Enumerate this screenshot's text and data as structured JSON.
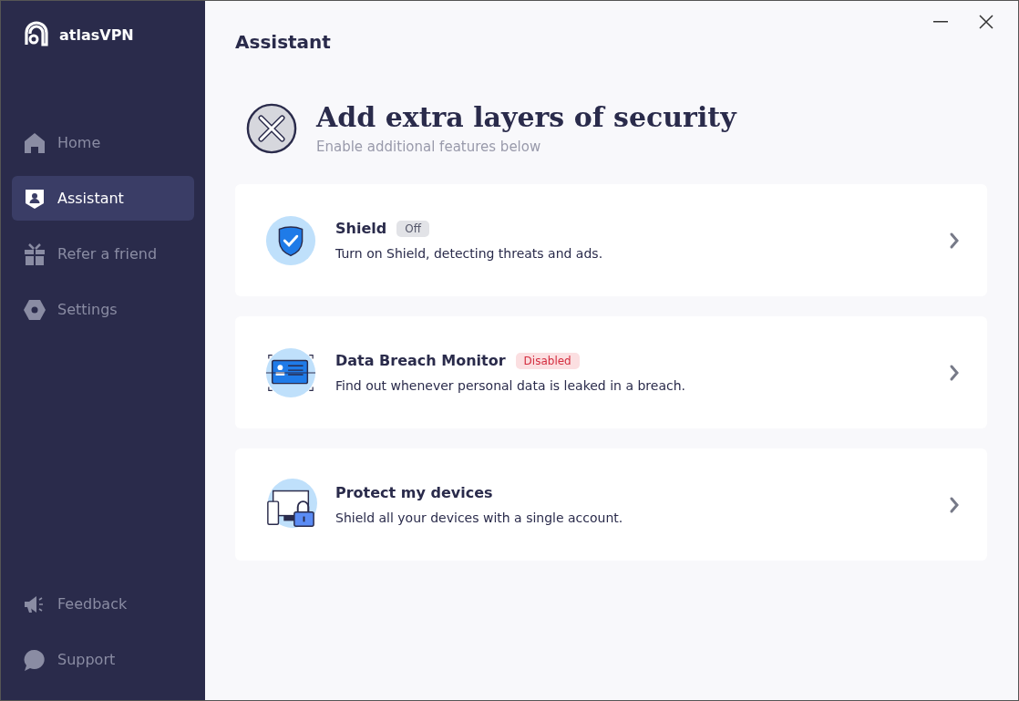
{
  "brand": {
    "name": "atlasVPN"
  },
  "sidebar": {
    "items": [
      {
        "label": "Home",
        "kind": "home",
        "selected": false
      },
      {
        "label": "Assistant",
        "kind": "assistant",
        "selected": true
      },
      {
        "label": "Refer a friend",
        "kind": "gift",
        "selected": false
      },
      {
        "label": "Settings",
        "kind": "settings",
        "selected": false
      }
    ],
    "footer_items": [
      {
        "label": "Feedback",
        "kind": "feedback"
      },
      {
        "label": "Support",
        "kind": "support"
      }
    ]
  },
  "page": {
    "title": "Assistant"
  },
  "hero": {
    "title": "Add extra layers of security",
    "subtitle": "Enable additional features below"
  },
  "cards": [
    {
      "kind": "shield",
      "title": "Shield",
      "badge": {
        "label": "Off",
        "kind": "off"
      },
      "description": "Turn on Shield, detecting threats and ads."
    },
    {
      "kind": "breach",
      "title": "Data Breach Monitor",
      "badge": {
        "label": "Disabled",
        "kind": "disabled"
      },
      "description": "Find out whenever personal data is leaked in a breach."
    },
    {
      "kind": "devices",
      "title": "Protect my devices",
      "description": "Shield all your devices with a single account."
    }
  ]
}
